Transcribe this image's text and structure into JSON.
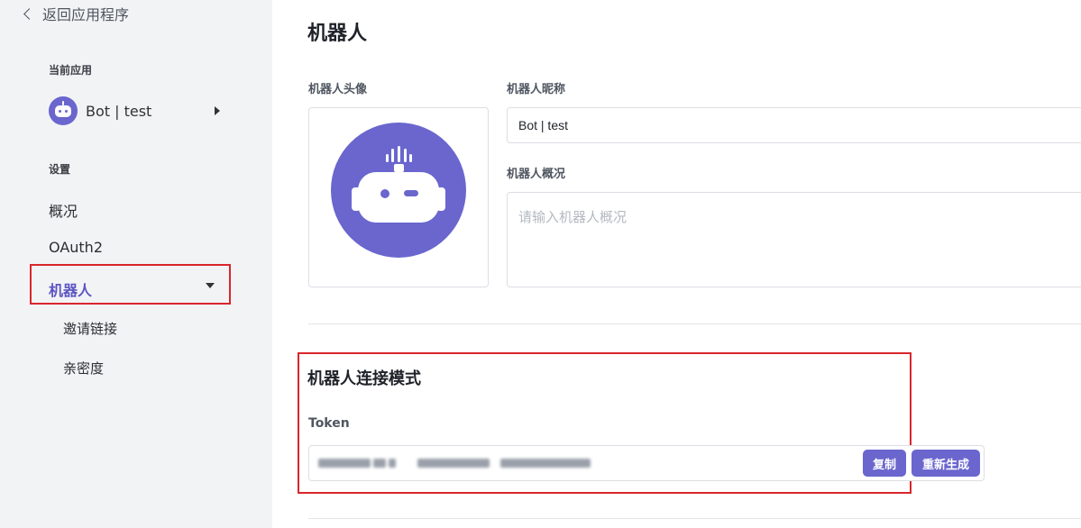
{
  "sidebar": {
    "back_label": "返回应用程序",
    "current_app_label": "当前应用",
    "app_name": "Bot | test",
    "settings_label": "设置",
    "items": [
      {
        "label": "概况"
      },
      {
        "label": "OAuth2"
      },
      {
        "label": "机器人",
        "active": true
      }
    ],
    "sub_items": [
      {
        "label": "邀请链接"
      },
      {
        "label": "亲密度"
      }
    ]
  },
  "main": {
    "title": "机器人",
    "avatar_label": "机器人头像",
    "nickname_label": "机器人昵称",
    "nickname_value": "Bot | test",
    "overview_label": "机器人概况",
    "overview_placeholder": "请输入机器人概况",
    "connection": {
      "title": "机器人连接模式",
      "token_label": "Token",
      "token_value": "(blurred)",
      "copy_button": "复制",
      "regenerate_button": "重新生成"
    }
  },
  "colors": {
    "accent": "#6a66ce",
    "highlight_border": "#d9262c",
    "sidebar_bg": "#f2f3f5"
  },
  "icons": [
    "chevron-left-icon",
    "bot-avatar-icon",
    "caret-right-icon",
    "caret-down-icon"
  ]
}
